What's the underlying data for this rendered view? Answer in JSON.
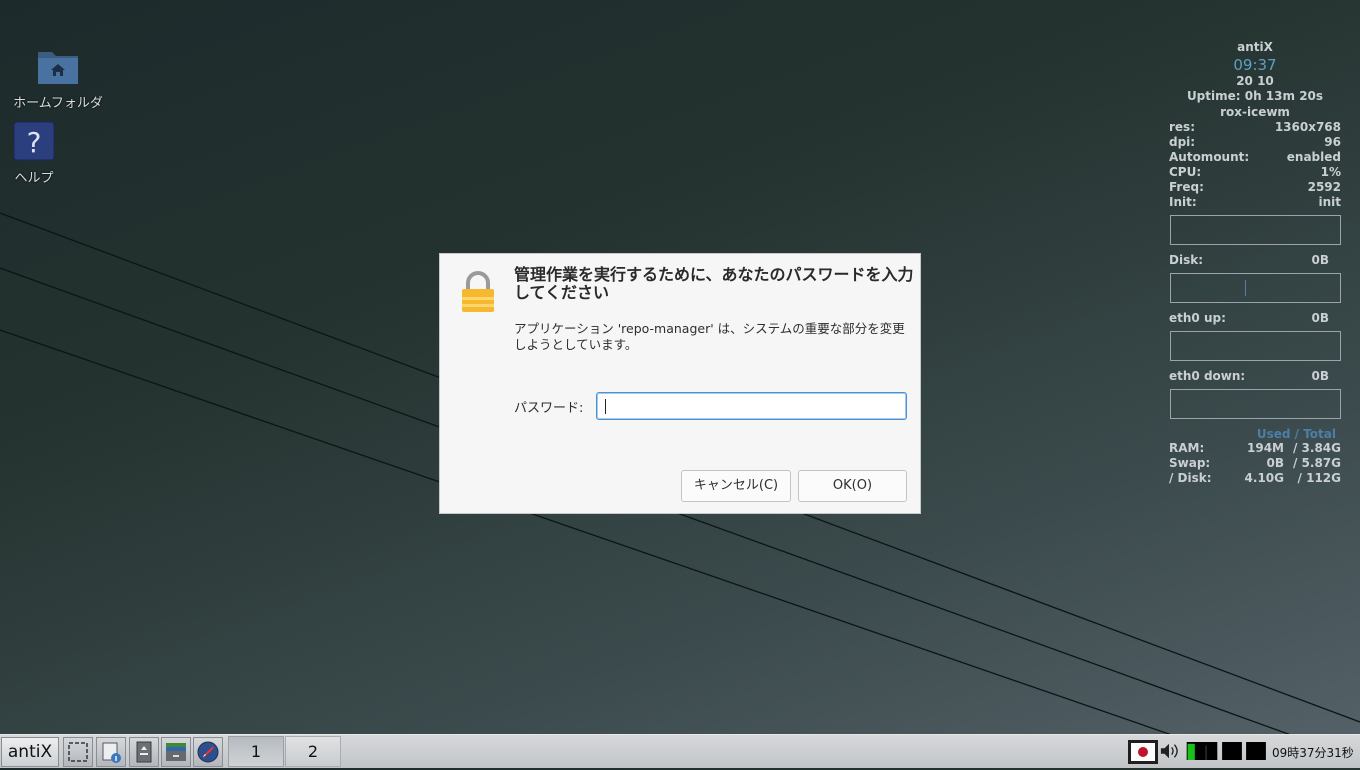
{
  "desktop": {
    "icons": [
      {
        "label": "ホームフォルダ",
        "icon": "home-folder-icon"
      },
      {
        "label": "ヘルプ",
        "icon": "help-icon"
      }
    ]
  },
  "conky": {
    "hostname": "antiX",
    "time": "09:37",
    "date": "20 10",
    "uptime": "Uptime: 0h 13m 20s",
    "wm": "rox-icewm",
    "info": [
      {
        "k": "res:",
        "v": "1360x768"
      },
      {
        "k": "dpi:",
        "v": "96"
      },
      {
        "k": "Automount:",
        "v": "enabled"
      },
      {
        "k": "CPU:",
        "v": "1%"
      },
      {
        "k": "Freq:",
        "v": "2592"
      },
      {
        "k": "Init:",
        "v": "init"
      }
    ],
    "disk": {
      "k": "Disk:",
      "v": "0B"
    },
    "eth_up": {
      "k": "eth0 up:",
      "v": "0B"
    },
    "eth_down": {
      "k": "eth0 down:",
      "v": "0B"
    },
    "used_total": "Used / Total",
    "mem": [
      {
        "k": "RAM:",
        "used": "194M",
        "total": "/ 3.84G"
      },
      {
        "k": "Swap:",
        "used": "0B",
        "total": "/ 5.87G"
      },
      {
        "k": "/ Disk:",
        "used": "4.10G",
        "total": "/ 112G"
      }
    ]
  },
  "dialog": {
    "title": "管理作業を実行するために、あなたのパスワードを入力してください",
    "message": "アプリケーション 'repo-manager' は、システムの重要な部分を変更しようとしています。",
    "password_label": "パスワード:",
    "password_value": "",
    "cancel_label": "キャンセル(C)",
    "ok_label": "OK(O)",
    "icon": "lock-icon"
  },
  "taskbar": {
    "start_label": "antiX",
    "quick_launch": [
      "show-desktop-icon",
      "file-manager-icon",
      "terminal-icon",
      "file-cabinet-icon",
      "browser-icon"
    ],
    "workspaces": [
      {
        "label": "1",
        "active": true
      },
      {
        "label": "2",
        "active": false
      }
    ],
    "tray": [
      "keyboard-flag-icon",
      "volume-icon",
      "cpu-monitor-icon",
      "net-monitor-icon",
      "mem-monitor-icon"
    ],
    "clock": "09時37分31秒"
  },
  "colors": {
    "accent": "#4a90d9",
    "conky_clock": "#5aa0c8",
    "conky_used_total": "#4d7fa6"
  }
}
